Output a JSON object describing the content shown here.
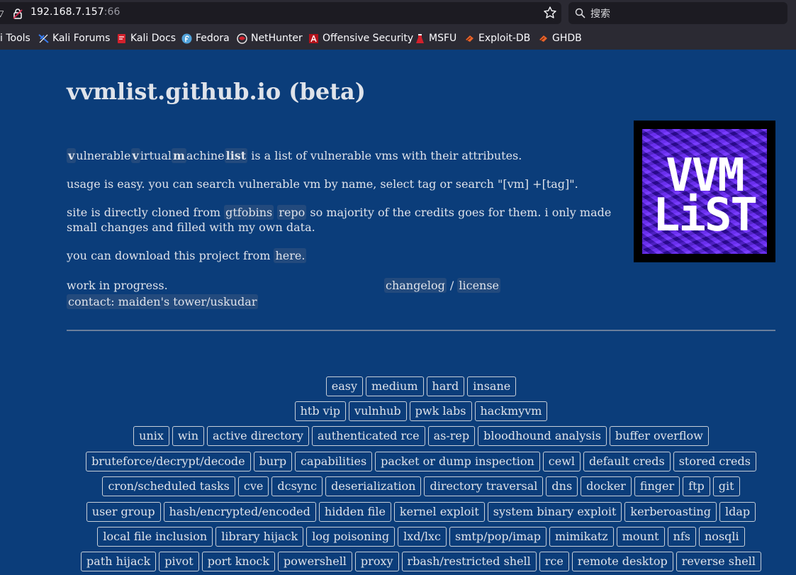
{
  "browser": {
    "url_host": "192.168.7.157",
    "url_port": ":66",
    "search_placeholder": "搜索",
    "bookmarks": [
      {
        "label": "i Tools",
        "icon": "kali-tools-icon"
      },
      {
        "label": "Kali Forums",
        "icon": "kali-forums-icon"
      },
      {
        "label": "Kali Docs",
        "icon": "kali-docs-icon"
      },
      {
        "label": "Fedora",
        "icon": "fedora-icon"
      },
      {
        "label": "NetHunter",
        "icon": "nethunter-icon"
      },
      {
        "label": "Offensive Security",
        "icon": "offsec-icon"
      },
      {
        "label": "MSFU",
        "icon": "msfu-icon"
      },
      {
        "label": "Exploit-DB",
        "icon": "exploitdb-icon"
      },
      {
        "label": "GHDB",
        "icon": "ghdb-icon"
      }
    ]
  },
  "page": {
    "title": "vvmlist.github.io (beta)",
    "intro": {
      "v1": "v",
      "ulnerable": "ulnerable",
      "v2": "v",
      "irtual": "irtual",
      "m": "m",
      "achine": "achine",
      "list": "list",
      "rest": " is a list of vulnerable vms with their attributes."
    },
    "usage": "usage is easy. you can search vulnerable vm by name, select tag or search \"[vm] +[tag]\".",
    "cloned": {
      "before": "site is directly cloned from ",
      "gtfobins": "gtfobins",
      "repo": "repo",
      "after": " so majority of the credits goes for them. i only made small changes and filled with my own data."
    },
    "download": {
      "before": "you can download this project from ",
      "link": "here."
    },
    "wip": "work in progress.",
    "changelog": "changelog",
    "slash": " / ",
    "license": "license",
    "contact": "contact: maiden's tower/uskudar",
    "logo": {
      "line1": "VVM",
      "line2": "LiST"
    }
  },
  "tags": {
    "row1": [
      "easy",
      "medium",
      "hard",
      "insane"
    ],
    "row2": [
      "htb vip",
      "vulnhub",
      "pwk labs",
      "hackmyvm"
    ],
    "row3": [
      "unix",
      "win",
      "active directory",
      "authenticated rce",
      "as-rep",
      "bloodhound analysis",
      "buffer overflow"
    ],
    "row4": [
      "bruteforce/decrypt/decode",
      "burp",
      "capabilities",
      "packet or dump inspection",
      "cewl",
      "default creds",
      "stored creds"
    ],
    "row5": [
      "cron/scheduled tasks",
      "cve",
      "dcsync",
      "deserialization",
      "directory traversal",
      "dns",
      "docker",
      "finger",
      "ftp",
      "git"
    ],
    "row6": [
      "user group",
      "hash/encrypted/encoded",
      "hidden file",
      "kernel exploit",
      "system binary exploit",
      "kerberoasting",
      "ldap"
    ],
    "row7": [
      "local file inclusion",
      "library hijack",
      "log poisoning",
      "lxd/lxc",
      "smtp/pop/imap",
      "mimikatz",
      "mount",
      "nfs",
      "nosqli"
    ],
    "row8": [
      "path hijack",
      "pivot",
      "port knock",
      "powershell",
      "proxy",
      "rbash/restricted shell",
      "rce",
      "remote desktop",
      "reverse shell"
    ]
  },
  "colors": {
    "background": "#0b3d7a",
    "text": "#dfe3ea",
    "code_bg": "#234a7d"
  }
}
